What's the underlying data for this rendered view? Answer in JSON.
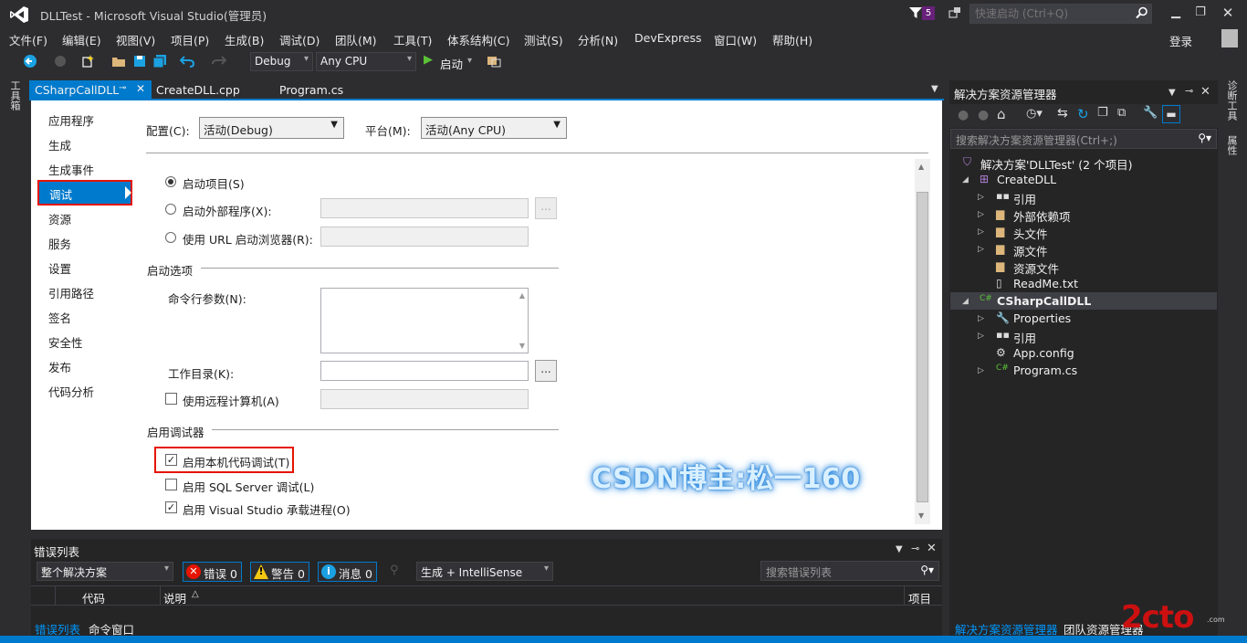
{
  "window": {
    "title": "DLLTest - Microsoft Visual Studio(管理员)",
    "notifications": "5",
    "quick_launch_placeholder": "快速启动 (Ctrl+Q)",
    "login": "登录"
  },
  "menu": [
    "文件(F)",
    "编辑(E)",
    "视图(V)",
    "项目(P)",
    "生成(B)",
    "调试(D)",
    "团队(M)",
    "工具(T)",
    "体系结构(C)",
    "测试(S)",
    "分析(N)",
    "DevExpress",
    "窗口(W)",
    "帮助(H)"
  ],
  "toolbar": {
    "config": "Debug",
    "platform": "Any CPU",
    "start": "启动"
  },
  "left_toolbox": "工具箱",
  "tabs": [
    {
      "label": "CSharpCallDLL",
      "active": true
    },
    {
      "label": "CreateDLL.cpp"
    },
    {
      "label": "Program.cs"
    }
  ],
  "nav": {
    "items": [
      "应用程序",
      "生成",
      "生成事件",
      "调试",
      "资源",
      "服务",
      "设置",
      "引用路径",
      "签名",
      "安全性",
      "发布",
      "代码分析"
    ],
    "selected": "调试"
  },
  "debug_page": {
    "config_label": "配置(C):",
    "config_value": "活动(Debug)",
    "platform_label": "平台(M):",
    "platform_value": "活动(Any CPU)",
    "start_action": {
      "start_project": "启动项目(S)",
      "start_external": "启动外部程序(X):",
      "start_url": "使用 URL 启动浏览器(R):"
    },
    "start_options": {
      "header": "启动选项",
      "cmd_args": "命令行参数(N):",
      "work_dir": "工作目录(K):",
      "remote": "使用远程计算机(A)",
      "browse": "..."
    },
    "debuggers": {
      "header": "启用调试器",
      "native": "启用本机代码调试(T)",
      "sql": "启用 SQL Server 调试(L)",
      "vs_host": "启用 Visual Studio 承载进程(O)"
    }
  },
  "watermark": "CSDN博主:松一160",
  "error_list": {
    "title": "错误列表",
    "scope": "整个解决方案",
    "errors": "错误 0",
    "warnings": "警告 0",
    "messages": "消息 0",
    "build_filter": "生成 + IntelliSense",
    "search_placeholder": "搜索错误列表",
    "columns": {
      "code": "代码",
      "desc": "说明",
      "project": "项目"
    },
    "tabs": {
      "errors": "错误列表",
      "command": "命令窗口"
    }
  },
  "solution_explorer": {
    "title": "解决方案资源管理器",
    "search_placeholder": "搜索解决方案资源管理器(Ctrl+;)",
    "solution": "解决方案'DLLTest' (2 个项目)",
    "proj1": {
      "name": "CreateDLL",
      "items": [
        "引用",
        "外部依赖项",
        "头文件",
        "源文件",
        "资源文件",
        "ReadMe.txt"
      ]
    },
    "proj2": {
      "name": "CSharpCallDLL",
      "items": [
        "Properties",
        "引用",
        "App.config",
        "Program.cs"
      ]
    },
    "bottom_tabs": {
      "sol": "解决方案资源管理器",
      "team": "团队资源管理器"
    }
  },
  "right_bar": {
    "diag": "诊断工具",
    "props": "属性"
  },
  "corner_logo": {
    "text": "2cto",
    "sub": ".com"
  }
}
